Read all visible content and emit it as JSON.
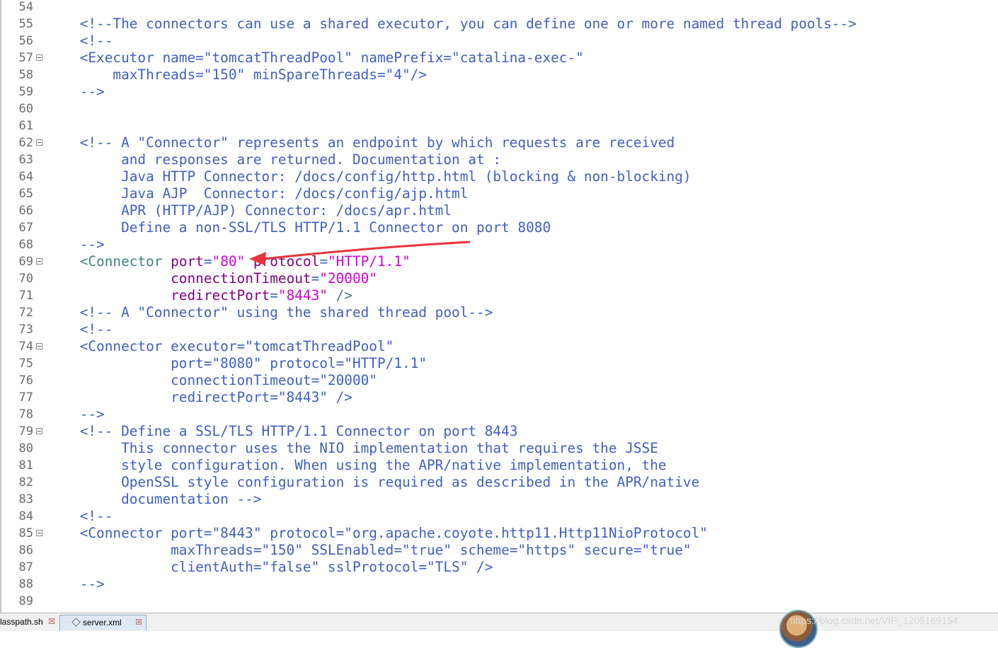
{
  "editor": {
    "lines": [
      {
        "n": "54",
        "fold": false,
        "segs": []
      },
      {
        "n": "55",
        "fold": false,
        "segs": [
          {
            "t": "    <!--The connectors can use a shared executor, you can define one or more named thread pools-->",
            "c": "c-comment"
          }
        ]
      },
      {
        "n": "56",
        "fold": false,
        "segs": [
          {
            "t": "    <!--",
            "c": "c-comment"
          }
        ]
      },
      {
        "n": "57",
        "fold": true,
        "segs": [
          {
            "t": "    <Executor name=\"tomcatThreadPool\" namePrefix=\"catalina-exec-\"",
            "c": "c-comment"
          }
        ]
      },
      {
        "n": "58",
        "fold": false,
        "segs": [
          {
            "t": "        maxThreads=\"150\" minSpareThreads=\"4\"/>",
            "c": "c-comment"
          }
        ]
      },
      {
        "n": "59",
        "fold": false,
        "segs": [
          {
            "t": "    -->",
            "c": "c-comment"
          }
        ]
      },
      {
        "n": "60",
        "fold": false,
        "segs": []
      },
      {
        "n": "61",
        "fold": false,
        "segs": []
      },
      {
        "n": "62",
        "fold": true,
        "segs": [
          {
            "t": "    <!-- A \"Connector\" represents an endpoint by which requests are received",
            "c": "c-comment"
          }
        ]
      },
      {
        "n": "63",
        "fold": false,
        "segs": [
          {
            "t": "         and responses are returned. Documentation at :",
            "c": "c-comment"
          }
        ]
      },
      {
        "n": "64",
        "fold": false,
        "segs": [
          {
            "t": "         Java HTTP Connector: /docs/config/http.html (blocking & non-blocking)",
            "c": "c-comment"
          }
        ]
      },
      {
        "n": "65",
        "fold": false,
        "segs": [
          {
            "t": "         Java AJP  Connector: /docs/config/ajp.html",
            "c": "c-comment"
          }
        ]
      },
      {
        "n": "66",
        "fold": false,
        "segs": [
          {
            "t": "         APR (HTTP/AJP) Connector: /docs/apr.html",
            "c": "c-comment"
          }
        ]
      },
      {
        "n": "67",
        "fold": false,
        "segs": [
          {
            "t": "         Define a non-SSL/TLS HTTP/1.1 Connector on port 8080",
            "c": "c-comment"
          }
        ]
      },
      {
        "n": "68",
        "fold": false,
        "segs": [
          {
            "t": "    -->",
            "c": "c-comment"
          }
        ]
      },
      {
        "n": "69",
        "fold": true,
        "segs": [
          {
            "t": "    <",
            "c": "c-tag"
          },
          {
            "t": "Connector",
            "c": "c-tag"
          },
          {
            "t": " ",
            "c": "c-plain"
          },
          {
            "t": "port",
            "c": "c-attr"
          },
          {
            "t": "=",
            "c": "c-plain"
          },
          {
            "t": "\"80\"",
            "c": "c-val"
          },
          {
            "t": " ",
            "c": "c-plain"
          },
          {
            "t": "protocol",
            "c": "c-attr"
          },
          {
            "t": "=",
            "c": "c-plain"
          },
          {
            "t": "\"HTTP/1.1\"",
            "c": "c-val"
          }
        ]
      },
      {
        "n": "70",
        "fold": false,
        "segs": [
          {
            "t": "               ",
            "c": "c-plain"
          },
          {
            "t": "connectionTimeout",
            "c": "c-attr"
          },
          {
            "t": "=",
            "c": "c-plain"
          },
          {
            "t": "\"20000\"",
            "c": "c-val"
          }
        ]
      },
      {
        "n": "71",
        "fold": false,
        "segs": [
          {
            "t": "               ",
            "c": "c-plain"
          },
          {
            "t": "redirectPort",
            "c": "c-attr"
          },
          {
            "t": "=",
            "c": "c-plain"
          },
          {
            "t": "\"8443\"",
            "c": "c-val"
          },
          {
            "t": " />",
            "c": "c-tag"
          }
        ]
      },
      {
        "n": "72",
        "fold": false,
        "segs": [
          {
            "t": "    <!-- A \"Connector\" using the shared thread pool-->",
            "c": "c-comment"
          }
        ]
      },
      {
        "n": "73",
        "fold": false,
        "segs": [
          {
            "t": "    <!--",
            "c": "c-comment"
          }
        ]
      },
      {
        "n": "74",
        "fold": true,
        "segs": [
          {
            "t": "    <Connector executor=\"tomcatThreadPool\"",
            "c": "c-comment"
          }
        ]
      },
      {
        "n": "75",
        "fold": false,
        "segs": [
          {
            "t": "               port=\"8080\" protocol=\"HTTP/1.1\"",
            "c": "c-comment"
          }
        ]
      },
      {
        "n": "76",
        "fold": false,
        "segs": [
          {
            "t": "               connectionTimeout=\"20000\"",
            "c": "c-comment"
          }
        ]
      },
      {
        "n": "77",
        "fold": false,
        "segs": [
          {
            "t": "               redirectPort=\"8443\" />",
            "c": "c-comment"
          }
        ]
      },
      {
        "n": "78",
        "fold": false,
        "segs": [
          {
            "t": "    -->",
            "c": "c-comment"
          }
        ]
      },
      {
        "n": "79",
        "fold": true,
        "segs": [
          {
            "t": "    <!-- Define a SSL/TLS HTTP/1.1 Connector on port 8443",
            "c": "c-comment"
          }
        ]
      },
      {
        "n": "80",
        "fold": false,
        "segs": [
          {
            "t": "         This connector uses the NIO implementation that requires the JSSE",
            "c": "c-comment"
          }
        ]
      },
      {
        "n": "81",
        "fold": false,
        "segs": [
          {
            "t": "         style configuration. When using the APR/native implementation, the",
            "c": "c-comment"
          }
        ]
      },
      {
        "n": "82",
        "fold": false,
        "segs": [
          {
            "t": "         OpenSSL style configuration is required as described in the APR/native",
            "c": "c-comment"
          }
        ]
      },
      {
        "n": "83",
        "fold": false,
        "segs": [
          {
            "t": "         documentation -->",
            "c": "c-comment"
          }
        ]
      },
      {
        "n": "84",
        "fold": false,
        "segs": [
          {
            "t": "    <!--",
            "c": "c-comment"
          }
        ]
      },
      {
        "n": "85",
        "fold": true,
        "segs": [
          {
            "t": "    <Connector port=\"8443\" protocol=\"org.apache.coyote.http11.Http11NioProtocol\"",
            "c": "c-comment"
          }
        ]
      },
      {
        "n": "86",
        "fold": false,
        "segs": [
          {
            "t": "               maxThreads=\"150\" SSLEnabled=\"true\" scheme=\"https\" secure=\"true\"",
            "c": "c-comment"
          }
        ]
      },
      {
        "n": "87",
        "fold": false,
        "segs": [
          {
            "t": "               clientAuth=\"false\" sslProtocol=\"TLS\" />",
            "c": "c-comment"
          }
        ]
      },
      {
        "n": "88",
        "fold": false,
        "segs": [
          {
            "t": "    -->",
            "c": "c-comment"
          }
        ]
      },
      {
        "n": "89",
        "fold": false,
        "segs": []
      }
    ]
  },
  "tabs": [
    {
      "label": "lasspath.sh",
      "close": "☒"
    },
    {
      "label": "server.xml",
      "close": "☒"
    }
  ],
  "watermark": "https://blog.csdn.net/VIP_1205169154",
  "annotation": {
    "color": "#e8343a"
  }
}
